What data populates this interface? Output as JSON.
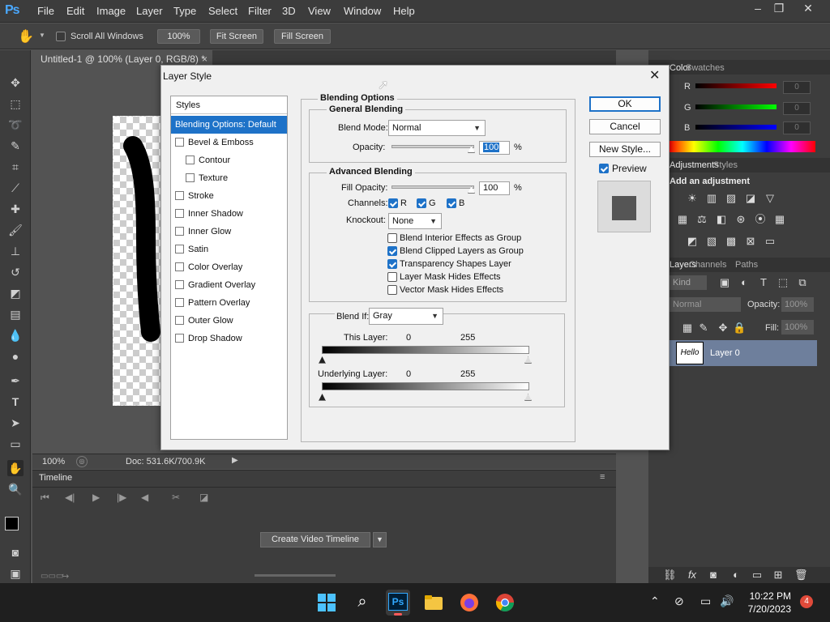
{
  "menubar": {
    "logo": "Ps",
    "items": [
      "File",
      "Edit",
      "Image",
      "Layer",
      "Type",
      "Select",
      "Filter",
      "3D",
      "View",
      "Window",
      "Help"
    ],
    "win_minimize": "–",
    "win_restore": "❐",
    "win_close": "✕"
  },
  "options": {
    "scroll_all_windows": "Scroll All Windows",
    "zoom_100": "100%",
    "fit_screen": "Fit Screen",
    "fill_screen": "Fill Screen"
  },
  "document": {
    "tab_title": "Untitled-1 @ 100% (Layer 0, RGB/8) *",
    "tab_close": "×",
    "zoom": "100%",
    "doc_size": "Doc: 531.6K/700.9K"
  },
  "timeline": {
    "title": "Timeline",
    "create_video": "Create Video Timeline"
  },
  "panels": {
    "color_tab": "Color",
    "swatches_tab": "Swatches",
    "r_label": "R",
    "g_label": "G",
    "b_label": "B",
    "r_value": "0",
    "g_value": "0",
    "b_value": "0",
    "adjustments_tab": "Adjustments",
    "styles_tab": "Styles",
    "add_adjustment": "Add an adjustment",
    "layers_tab": "Layers",
    "channels_tab": "Channels",
    "paths_tab": "Paths",
    "kind": "Kind",
    "blend": "Normal",
    "opacity_label": "Opacity:",
    "opacity_value": "100%",
    "lock_label": "Lock:",
    "fill_label": "Fill:",
    "fill_value": "100%",
    "layer_name": "Layer 0",
    "layer_thumb_text": "Hello"
  },
  "dialog": {
    "title": "Layer Style",
    "close": "✕",
    "styles_header": "Styles",
    "styles": [
      {
        "label": "Blending Options: Default",
        "active": true
      },
      {
        "label": "Bevel & Emboss",
        "checked": false
      },
      {
        "label": "Contour",
        "checked": false,
        "indent": true
      },
      {
        "label": "Texture",
        "checked": false,
        "indent": true
      },
      {
        "label": "Stroke",
        "checked": false
      },
      {
        "label": "Inner Shadow",
        "checked": false
      },
      {
        "label": "Inner Glow",
        "checked": false
      },
      {
        "label": "Satin",
        "checked": false
      },
      {
        "label": "Color Overlay",
        "checked": false
      },
      {
        "label": "Gradient Overlay",
        "checked": false
      },
      {
        "label": "Pattern Overlay",
        "checked": false
      },
      {
        "label": "Outer Glow",
        "checked": false
      },
      {
        "label": "Drop Shadow",
        "checked": false
      }
    ],
    "blending_options": "Blending Options",
    "general_blending": "General Blending",
    "blend_mode_label": "Blend Mode:",
    "blend_mode": "Normal",
    "opacity_label": "Opacity:",
    "opacity": "100",
    "percent": "%",
    "advanced_blending": "Advanced Blending",
    "fill_opacity_label": "Fill Opacity:",
    "fill_opacity": "100",
    "channels_label": "Channels:",
    "channel_r": "R",
    "channel_g": "G",
    "channel_b": "B",
    "knockout_label": "Knockout:",
    "knockout": "None",
    "options": [
      {
        "label": "Blend Interior Effects as Group",
        "checked": false
      },
      {
        "label": "Blend Clipped Layers as Group",
        "checked": true
      },
      {
        "label": "Transparency Shapes Layer",
        "checked": true
      },
      {
        "label": "Layer Mask Hides Effects",
        "checked": false
      },
      {
        "label": "Vector Mask Hides Effects",
        "checked": false
      }
    ],
    "blend_if_label": "Blend If:",
    "blend_if": "Gray",
    "this_layer": "This Layer:",
    "underlying_layer": "Underlying Layer:",
    "range_min": "0",
    "range_max": "255",
    "ok": "OK",
    "cancel": "Cancel",
    "new_style": "New Style...",
    "preview": "Preview"
  },
  "taskbar": {
    "time": "10:22 PM",
    "date": "7/20/2023",
    "notifications": "4"
  },
  "colors": {
    "accent": "#1e72c8",
    "ps_blue": "#4aa8ff",
    "selected_row": "#1e72c8"
  }
}
